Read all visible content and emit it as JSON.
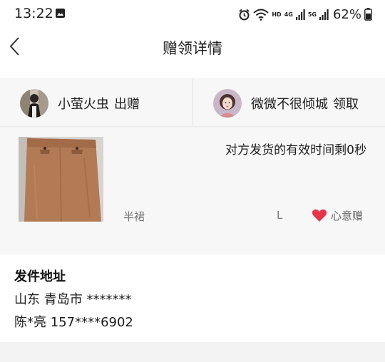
{
  "status_bar": {
    "time": "13:22",
    "network_hd": "HD",
    "network_4g": "4G",
    "network_5g": "5G",
    "battery_text": "62%",
    "icons": [
      "image-icon",
      "alarm-icon",
      "wifi-icon",
      "signal-icon",
      "battery-icon"
    ]
  },
  "header": {
    "title": "赠领详情"
  },
  "giver": {
    "name": "小萤火虫",
    "action": "出赠"
  },
  "receiver": {
    "name": "微微不很倾城",
    "action": "领取"
  },
  "item": {
    "timer_text": "对方发货的有效时间剩0秒",
    "name": "半裙",
    "size": "L",
    "tag": "心意赠",
    "tag_color": "#e8334a"
  },
  "address": {
    "title": "发件地址",
    "line1": "山东 青岛市 *******",
    "line2": "陈*亮 157****6902"
  }
}
